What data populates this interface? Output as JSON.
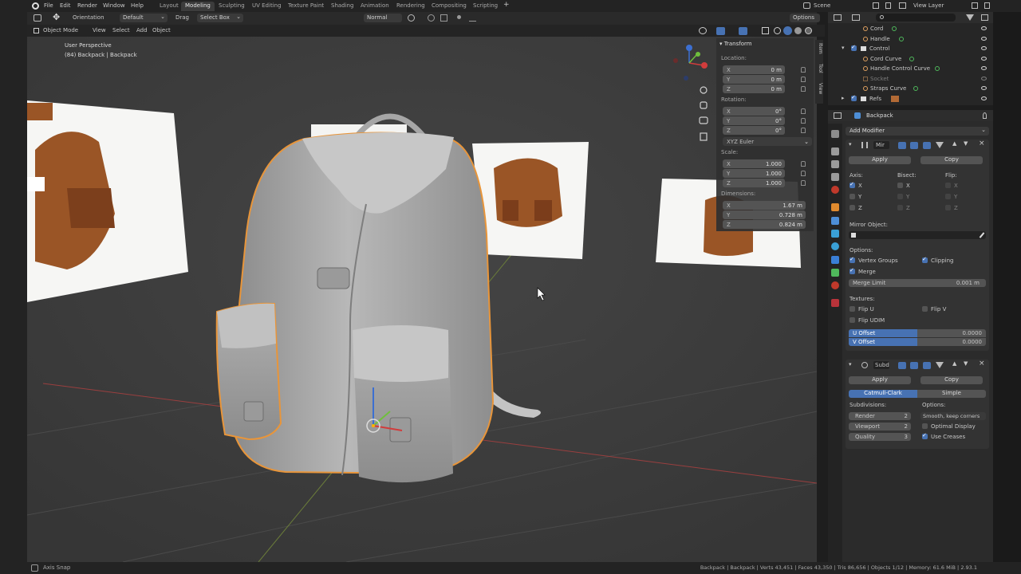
{
  "menu": {
    "file": "File",
    "edit": "Edit",
    "render": "Render",
    "window": "Window",
    "help": "Help"
  },
  "workspaces": [
    "Layout",
    "Modeling",
    "Sculpting",
    "UV Editing",
    "Texture Paint",
    "Shading",
    "Animation",
    "Rendering",
    "Compositing",
    "Scripting"
  ],
  "active_workspace": "Modeling",
  "add_tab": "+",
  "scene": "Scene",
  "view_layer": "View Layer",
  "vp_header": {
    "orientation_label": "Orientation",
    "orientation_value": "Default",
    "drag_label": "Drag",
    "drag_value": "Select Box",
    "pivot": "Normal",
    "options": "Options"
  },
  "vp_header2": {
    "mode": "Object Mode",
    "view": "View",
    "select": "Select",
    "add": "Add",
    "object": "Object"
  },
  "viewport": {
    "perspective": "User Perspective",
    "object_info": "(84) Backpack | Backpack"
  },
  "npanel": {
    "section": "Transform",
    "location_label": "Location:",
    "location": [
      {
        "axis": "X",
        "value": "0 m"
      },
      {
        "axis": "Y",
        "value": "0 m"
      },
      {
        "axis": "Z",
        "value": "0 m"
      }
    ],
    "rotation_label": "Rotation:",
    "rotation": [
      {
        "axis": "X",
        "value": "0°"
      },
      {
        "axis": "Y",
        "value": "0°"
      },
      {
        "axis": "Z",
        "value": "0°"
      }
    ],
    "rotation_mode": "XYZ Euler",
    "scale_label": "Scale:",
    "scale": [
      {
        "axis": "X",
        "value": "1.000"
      },
      {
        "axis": "Y",
        "value": "1.000"
      },
      {
        "axis": "Z",
        "value": "1.000"
      }
    ],
    "dimensions_label": "Dimensions:",
    "dimensions": [
      {
        "axis": "X",
        "value": "1.67 m"
      },
      {
        "axis": "Y",
        "value": "0.728 m"
      },
      {
        "axis": "Z",
        "value": "0.824 m"
      }
    ],
    "side_tabs": [
      "Item",
      "Tool",
      "View"
    ]
  },
  "outliner": {
    "rows": [
      {
        "label": "Cord"
      },
      {
        "label": "Handle"
      },
      {
        "label": "Control"
      },
      {
        "label": "Cord Curve"
      },
      {
        "label": "Handle Control Curve"
      },
      {
        "label": "Socket"
      },
      {
        "label": "Straps Curve"
      },
      {
        "label": "Refs"
      }
    ]
  },
  "properties": {
    "object_name": "Backpack",
    "add_modifier": "Add Modifier",
    "mirror": {
      "name": "Mir",
      "apply": "Apply",
      "copy": "Copy",
      "axis_label": "Axis:",
      "bisect_label": "Bisect:",
      "flip_label": "Flip:",
      "axes": [
        "X",
        "Y",
        "Z"
      ],
      "mirror_object": "Mirror Object:",
      "options_label": "Options:",
      "vertex_groups": "Vertex Groups",
      "clipping": "Clipping",
      "merge": "Merge",
      "merge_limit_label": "Merge Limit",
      "merge_limit_value": "0.001 m",
      "textures_label": "Textures:",
      "flip_u": "Flip U",
      "flip_v": "Flip V",
      "flip_udim": "Flip UDIM",
      "u_offset_label": "U Offset",
      "u_offset_value": "0.0000",
      "v_offset_label": "V Offset",
      "v_offset_value": "0.0000"
    },
    "subsurf": {
      "name": "Subd",
      "apply": "Apply",
      "copy": "Copy",
      "catmull": "Catmull-Clark",
      "simple": "Simple",
      "subdivisions_label": "Subdivisions:",
      "render_label": "Render",
      "render_value": "2",
      "viewport_label": "Viewport",
      "viewport_value": "2",
      "quality_label": "Quality",
      "quality_value": "3",
      "options_label": "Options:",
      "uv_smooth": "Smooth, keep corners",
      "optimal_display": "Optimal Display",
      "use_creases": "Use Creases"
    }
  },
  "statusbar": {
    "left": "Axis Snap",
    "right": "Backpack | Backpack | Verts 43,451 | Faces 43,350 | Tris 86,656 | Objects 1/12 | Memory: 61.6 MiB | 2.93.1"
  },
  "colors": {
    "accent": "#4772b3",
    "selection_outline": "#e8953a",
    "leather": "#9a5526"
  }
}
